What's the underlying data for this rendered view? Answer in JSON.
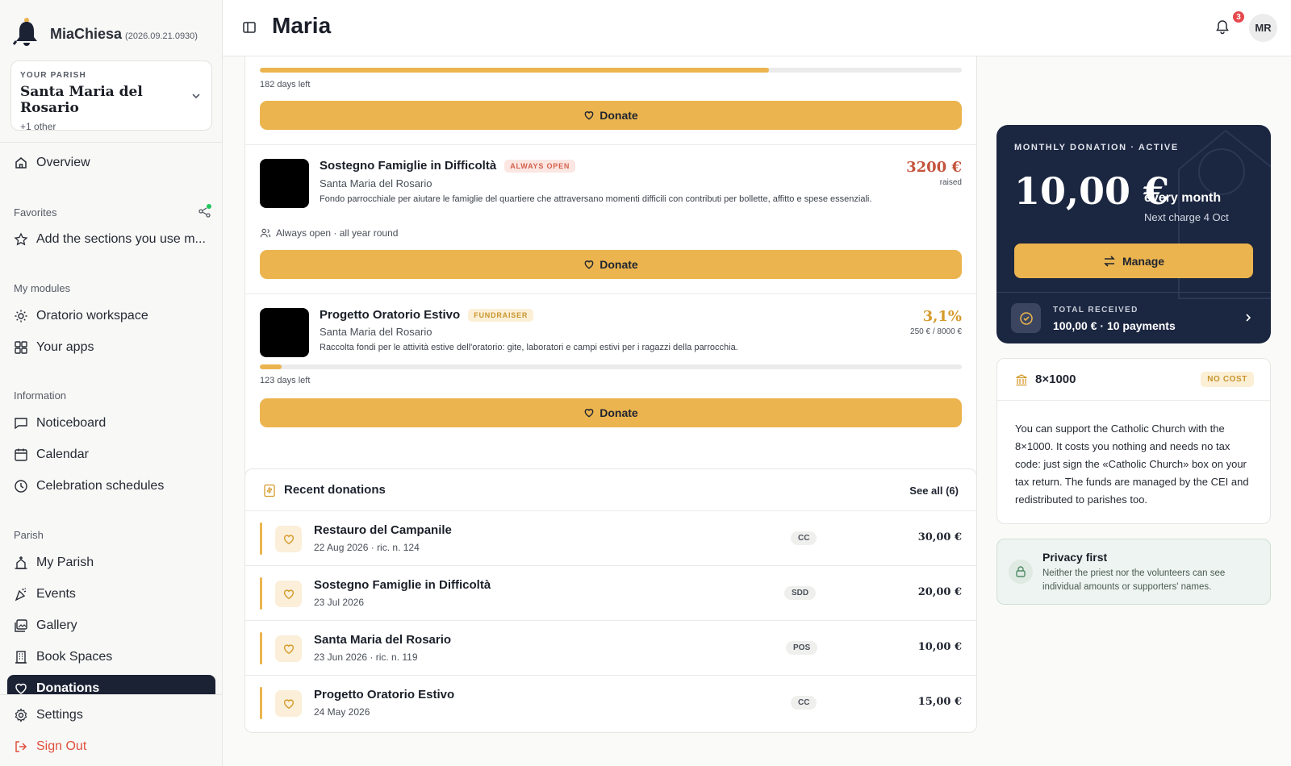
{
  "app": {
    "name": "MiaChiesa",
    "version": "(2026.09.21.0930)"
  },
  "parish_selector": {
    "label": "YOUR PARISH",
    "name": "Santa Maria del Rosario",
    "others": "+1 other"
  },
  "nav": {
    "overview": "Overview",
    "favorites_label": "Favorites",
    "favorites_hint": "Add the sections you use m...",
    "modules_label": "My modules",
    "modules": [
      "Oratorio workspace",
      "Your apps"
    ],
    "information_label": "Information",
    "information": [
      "Noticeboard",
      "Calendar",
      "Celebration schedules"
    ],
    "parish_label": "Parish",
    "parish": [
      "My Parish",
      "Events",
      "Gallery",
      "Book Spaces",
      "Donations"
    ],
    "settings": "Settings",
    "sign_out": "Sign Out"
  },
  "header": {
    "title": "Maria",
    "notifications": "3",
    "avatar": "MR"
  },
  "campaigns": {
    "first": {
      "days_left": "182 days left",
      "progress": 0.725,
      "donate": "Donate"
    },
    "items": [
      {
        "title": "Sostegno Famiglie in Difficoltà",
        "tag": "ALWAYS OPEN",
        "parish": "Santa Maria del Rosario",
        "description": "Fondo parrocchiale per aiutare le famiglie del quartiere che attraversano momenti difficili con contributi per bollette, affitto e spese essenziali.",
        "amount": "3200 €",
        "amount_sub": "raised",
        "footer": "Always open · all year round",
        "donate": "Donate",
        "amount_color": "#c4533c"
      },
      {
        "title": "Progetto Oratorio Estivo",
        "tag": "FUNDRAISER",
        "parish": "Santa Maria del Rosario",
        "description": "Raccolta fondi per le attività estive dell'oratorio: gite, laboratori e campi estivi per i ragazzi della parrocchia.",
        "amount": "3,1%",
        "amount_sub": "250 € / 8000 €",
        "progress": 0.031,
        "days_left": "123 days left",
        "donate": "Donate",
        "amount_color": "#d59a2b"
      }
    ]
  },
  "recent": {
    "title": "Recent donations",
    "see_all": "See all (6)",
    "rows": [
      {
        "name": "Restauro del Campanile",
        "date": "22 Aug 2026 · ric. n. 124",
        "method": "CC",
        "amount": "30,00 €"
      },
      {
        "name": "Sostegno Famiglie in Difficoltà",
        "date": "23 Jul 2026",
        "method": "SDD",
        "amount": "20,00 €"
      },
      {
        "name": "Santa Maria del Rosario",
        "date": "23 Jun 2026 · ric. n. 119",
        "method": "POS",
        "amount": "10,00 €"
      },
      {
        "name": "Progetto Oratorio Estivo",
        "date": "24 May 2026",
        "method": "CC",
        "amount": "15,00 €"
      }
    ]
  },
  "monthly": {
    "label": "MONTHLY DONATION · ACTIVE",
    "amount": "10,00 €",
    "period": "every month",
    "next_charge": "Next charge 4 Oct",
    "manage": "Manage",
    "total_label": "TOTAL RECEIVED",
    "total_value": "100,00 € · 10 payments"
  },
  "otto_per_mille": {
    "title": "8×1000",
    "badge": "NO COST",
    "body": "You can support the Catholic Church with the 8×1000. It costs you nothing and needs no tax code: just sign the «Catholic Church» box on your tax return. The funds are managed by the CEI and redistributed to parishes too."
  },
  "privacy": {
    "title": "Privacy first",
    "body": "Neither the priest nor the volunteers can see individual amounts or supporters' names."
  },
  "colors": {
    "accent": "#ebb44e",
    "dark": "#1b2640",
    "danger": "#e0503c"
  }
}
